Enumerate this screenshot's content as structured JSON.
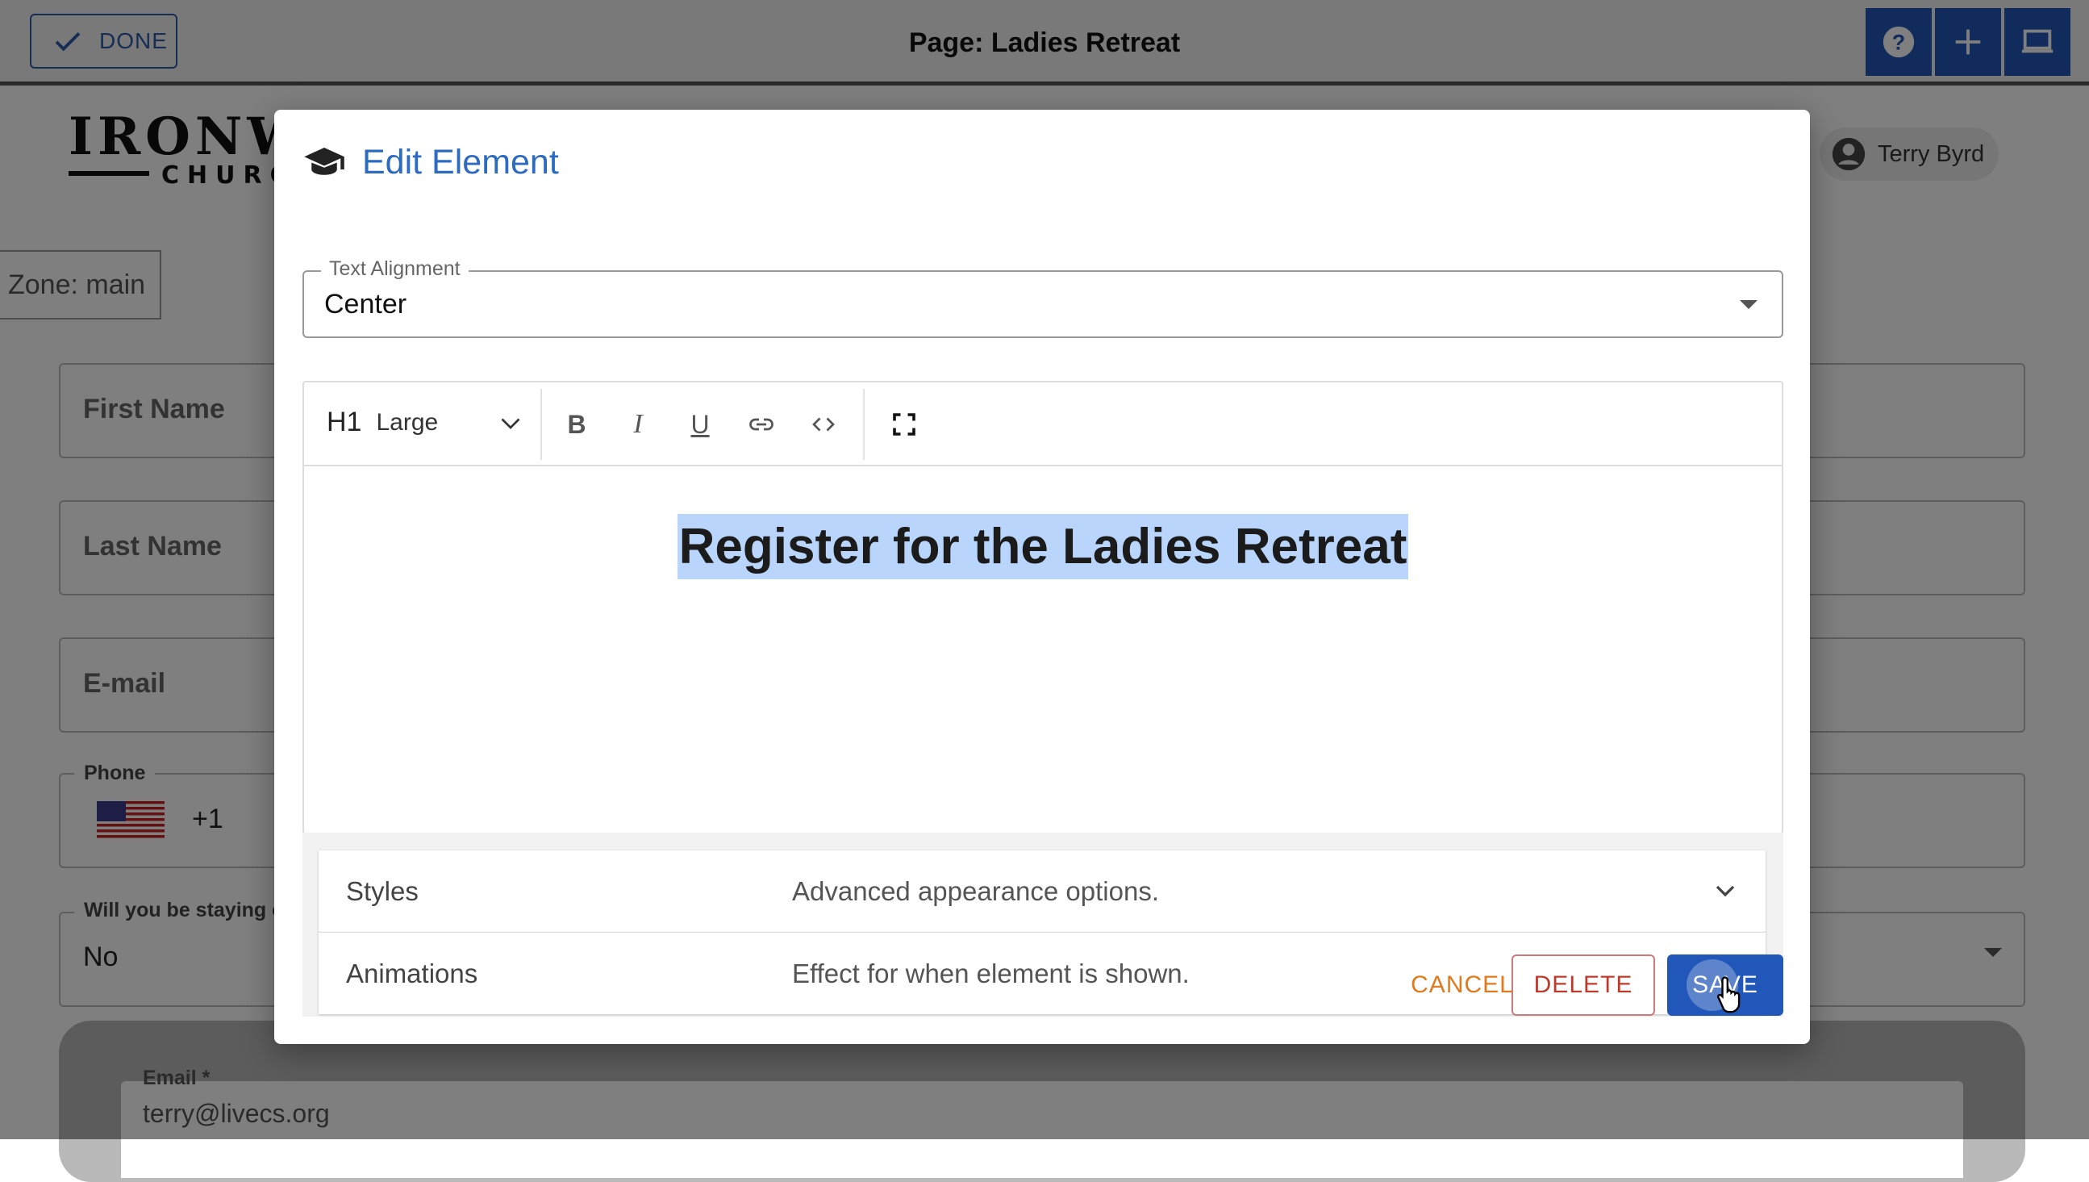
{
  "topbar": {
    "done_label": "DONE",
    "page_title": "Page: Ladies Retreat",
    "icons": [
      "help-icon",
      "plus-icon",
      "monitor-icon"
    ]
  },
  "logo": {
    "main": "IRONWC",
    "sub": "CHURC"
  },
  "user": {
    "name": "Terry Byrd"
  },
  "zone": {
    "label": "Zone: main"
  },
  "form_background": {
    "first_name": "First Name",
    "last_name": "Last Name",
    "email": "E-mail",
    "phone_label": "Phone",
    "phone_code": "+1",
    "staying_label": "Will you be staying o",
    "staying_value": "No",
    "email_label": "Email *",
    "email_value": "terry@livecs.org"
  },
  "dialog": {
    "title": "Edit Element",
    "text_alignment": {
      "label": "Text Alignment",
      "value": "Center"
    },
    "toolbar": {
      "heading_level": "H1",
      "heading_size": "Large",
      "bold": "B",
      "italic": "I",
      "underline": "U"
    },
    "content": "Register for the Ladies Retreat",
    "accordions": [
      {
        "title": "Styles",
        "description": "Advanced appearance options."
      },
      {
        "title": "Animations",
        "description": "Effect for when element is shown."
      }
    ],
    "buttons": {
      "cancel": "CANCEL",
      "delete": "DELETE",
      "save": "SAVE"
    }
  },
  "colors": {
    "primary": "#2057b8",
    "title_blue": "#2c6bc0",
    "cancel": "#e07a1c",
    "delete": "#c0392b",
    "selection": "#b9d5fb"
  }
}
